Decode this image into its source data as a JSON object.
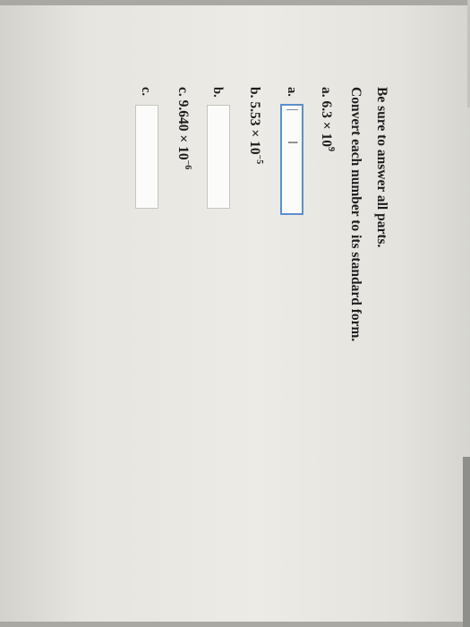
{
  "instructions": {
    "line1": "Be sure to answer all parts.",
    "line2": "Convert each number to its standard form."
  },
  "questions": [
    {
      "label": "a.",
      "mantissa": "6.3",
      "times": "×",
      "base": "10",
      "exponent": "9"
    },
    {
      "label": "b.",
      "mantissa": "5.53",
      "times": "×",
      "base": "10",
      "exponent": "−5"
    },
    {
      "label": "c.",
      "mantissa": "9.640",
      "times": "×",
      "base": "10",
      "exponent": "−6"
    }
  ],
  "answers": [
    {
      "label": "a.",
      "value": ""
    },
    {
      "label": "b.",
      "value": ""
    },
    {
      "label": "c.",
      "value": ""
    }
  ],
  "icons": {
    "text_cursor": "I-beam"
  },
  "colors": {
    "focus_border": "#5b8fd0",
    "box_border": "#c7c4bf"
  }
}
